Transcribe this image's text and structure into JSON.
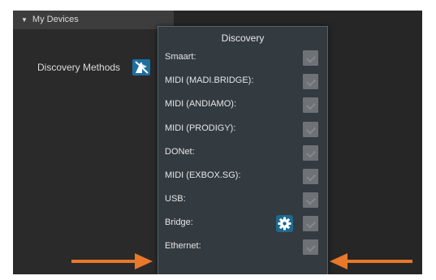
{
  "header": {
    "title": "My Devices",
    "caret_icon": "triangle-down-icon"
  },
  "sidebar": {
    "discovery_methods_label": "Discovery Methods",
    "discovery_icon": "discovery-icon"
  },
  "popup": {
    "title": "Discovery",
    "rows": [
      {
        "label": "Smaart:",
        "checked": false
      },
      {
        "label": "MIDI (MADI.BRIDGE):",
        "checked": false
      },
      {
        "label": "MIDI (ANDIAMO):",
        "checked": false
      },
      {
        "label": "MIDI (PRODIGY):",
        "checked": false
      },
      {
        "label": "DONet:",
        "checked": false
      },
      {
        "label": "MIDI (EXBOX.SG):",
        "checked": false
      },
      {
        "label": "USB:",
        "checked": false
      },
      {
        "label": "Bridge:",
        "checked": false,
        "has_settings": true
      },
      {
        "label": "Ethernet:",
        "checked": false
      }
    ]
  },
  "colors": {
    "accent": "#1e6fa0",
    "arrow": "#e8782a",
    "panel": "#333a40",
    "background": "#262626"
  }
}
